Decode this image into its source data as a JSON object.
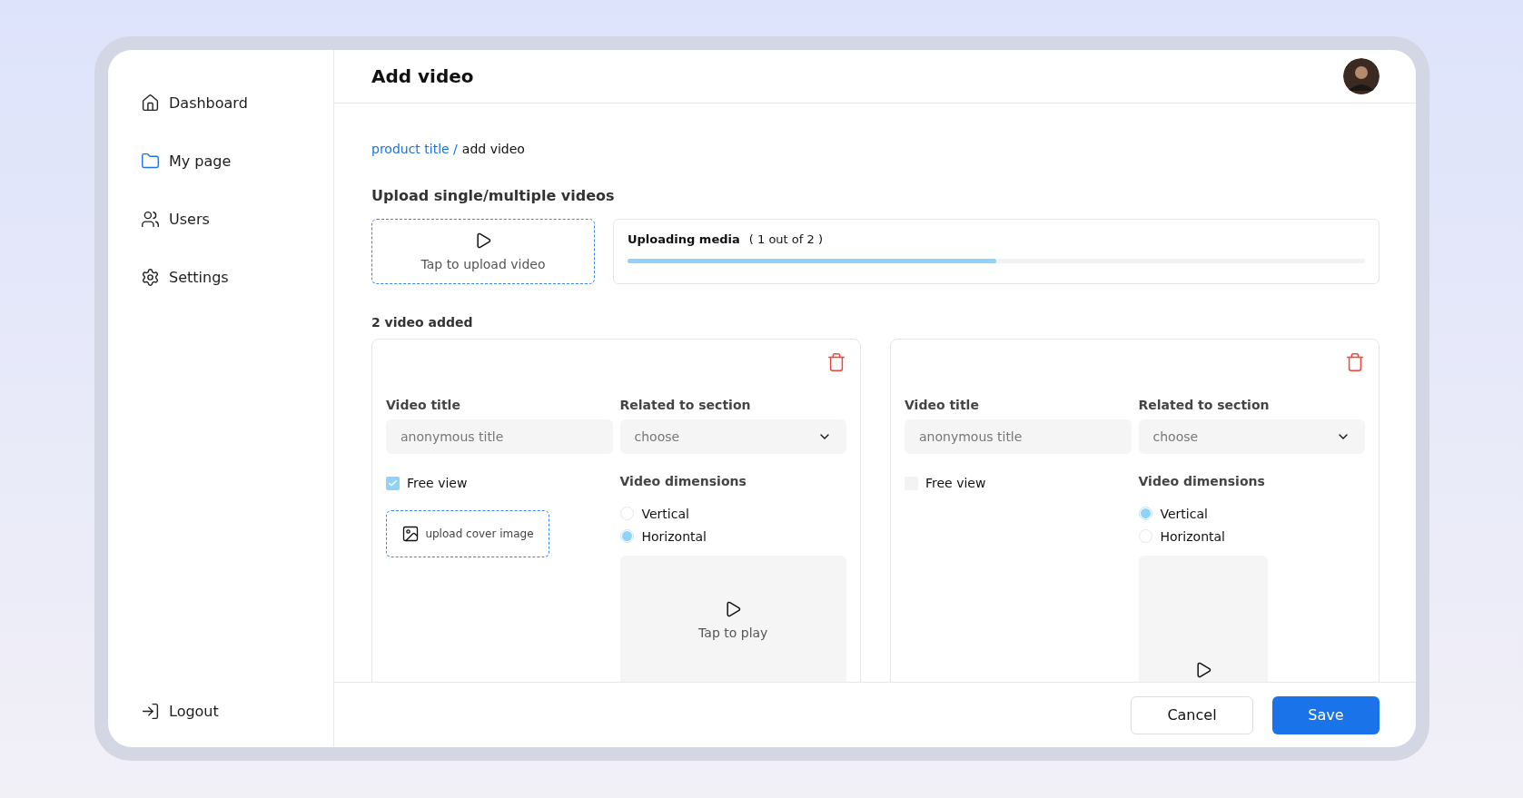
{
  "sidebar": {
    "items": [
      {
        "label": "Dashboard",
        "kind": "home"
      },
      {
        "label": "My page",
        "kind": "folder"
      },
      {
        "label": "Users",
        "kind": "users"
      },
      {
        "label": "Settings",
        "kind": "settings"
      }
    ],
    "logout": "Logout"
  },
  "header": {
    "title": "Add video"
  },
  "breadcrumb": {
    "link": "product title /",
    "current": "add video"
  },
  "upload": {
    "heading": "Upload single/multiple videos",
    "dropzone": "Tap to upload video",
    "progress": {
      "title": "Uploading media",
      "count": "( 1 out of 2 )",
      "level": 0.5
    }
  },
  "videos_count": "2 video added",
  "videos": [
    {
      "title_label": "Video title",
      "title_placeholder": "anonymous title",
      "section_label": "Related to section",
      "section_placeholder": "choose",
      "free_view": {
        "label": "Free view",
        "checked": true
      },
      "cover_upload": "upload cover image",
      "dimensions_label": "Video dimensions",
      "options": [
        {
          "label": "Vertical",
          "selected": false
        },
        {
          "label": "Horizontal",
          "selected": true
        }
      ],
      "preview_label": "Tap to play"
    },
    {
      "title_label": "Video title",
      "title_placeholder": "anonymous title",
      "section_label": "Related to section",
      "section_placeholder": "choose",
      "free_view": {
        "label": "Free view",
        "checked": false
      },
      "dimensions_label": "Video dimensions",
      "options": [
        {
          "label": "Vertical",
          "selected": true
        },
        {
          "label": "Horizontal",
          "selected": false
        }
      ]
    }
  ],
  "footer": {
    "cancel": "Cancel",
    "save": "Save"
  }
}
